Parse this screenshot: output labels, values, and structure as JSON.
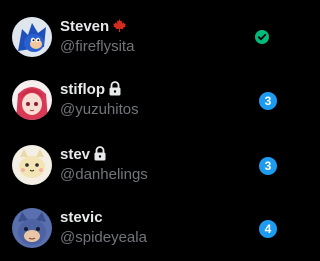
{
  "accounts": [
    {
      "display_name": "Steven",
      "handle": "@fireflysita",
      "name_icon": "maple-leaf-icon",
      "status": "check-icon",
      "badge": null
    },
    {
      "display_name": "stiflop",
      "handle": "@yuzuhitos",
      "name_icon": "lock-icon",
      "status": null,
      "badge": "3"
    },
    {
      "display_name": "stev",
      "handle": "@danhelings",
      "name_icon": "lock-icon",
      "status": null,
      "badge": "3"
    },
    {
      "display_name": "stevic",
      "handle": "@spideyeala",
      "name_icon": null,
      "status": null,
      "badge": "4"
    }
  ],
  "colors": {
    "background": "#000000",
    "primary_text": "#e7e9ea",
    "secondary_text": "#71767b",
    "badge_blue": "#1d9bf0",
    "check_green": "#00ba7c",
    "maple_red": "#d52b1e"
  }
}
